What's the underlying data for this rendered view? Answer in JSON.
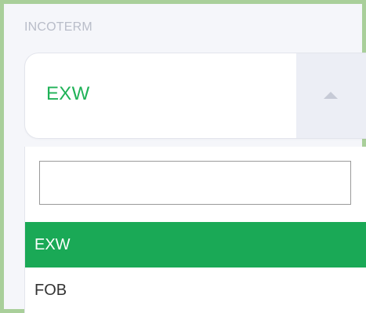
{
  "field": {
    "label": "INCOTERM",
    "selected_value": "EXW",
    "arrow_icon": "caret-up-icon"
  },
  "dropdown": {
    "search": {
      "value": "",
      "placeholder": ""
    },
    "options": [
      {
        "label": "EXW",
        "selected": true
      },
      {
        "label": "FOB",
        "selected": false
      }
    ]
  },
  "colors": {
    "accent": "#1aa956",
    "selected_text": "#1fb257",
    "label": "#b9bdc9",
    "frame": "#a9cf9a"
  }
}
